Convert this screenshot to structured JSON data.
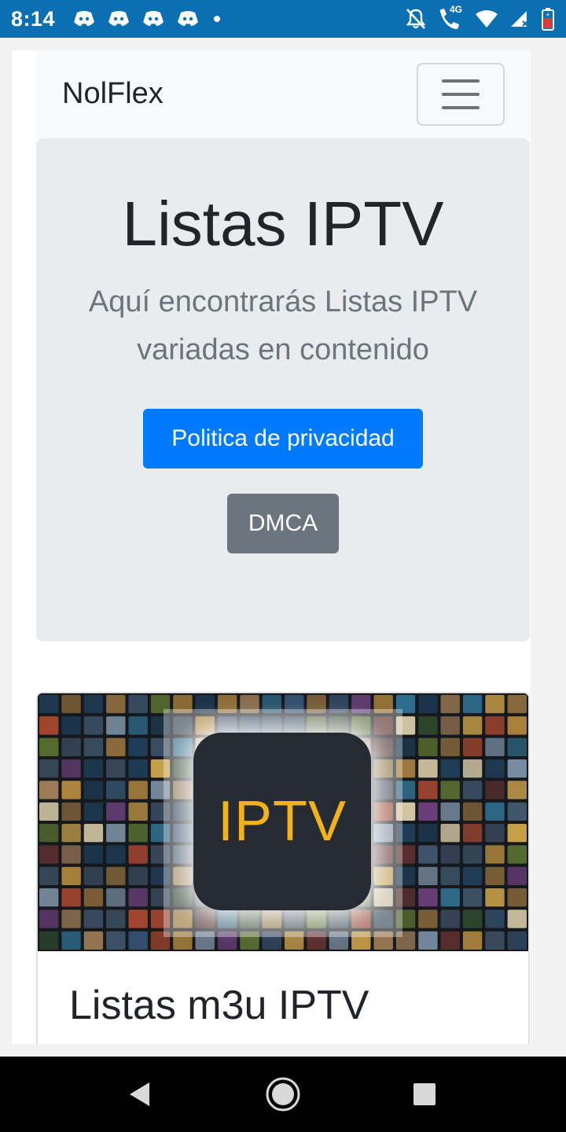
{
  "status_bar": {
    "time": "8:14",
    "network_label": "4G",
    "icons": [
      "discord-icon",
      "discord-icon",
      "discord-icon",
      "discord-icon",
      "dot-icon",
      "mute-icon",
      "wifi-call-icon",
      "wifi-icon",
      "signal-icon",
      "battery-icon"
    ]
  },
  "navbar": {
    "brand": "NolFlex",
    "toggler_icon": "hamburger-icon"
  },
  "jumbotron": {
    "title": "Listas IPTV",
    "lead": "Aquí encontrarás Listas IPTV variadas en contenido",
    "primary_button": "Politica de privacidad",
    "secondary_button": "DMCA"
  },
  "card": {
    "image_label": "IPTV",
    "title": "Listas m3u IPTV"
  },
  "system_nav": {
    "back": "back-icon",
    "home": "home-icon",
    "recents": "recents-icon"
  },
  "colors": {
    "status_bar": "#0a6fb3",
    "primary": "#007bff",
    "secondary": "#6c757d",
    "jumbotron_bg": "#e9ecef",
    "navbar_bg": "#f8f9fa",
    "badge_text": "#f2b21c"
  }
}
